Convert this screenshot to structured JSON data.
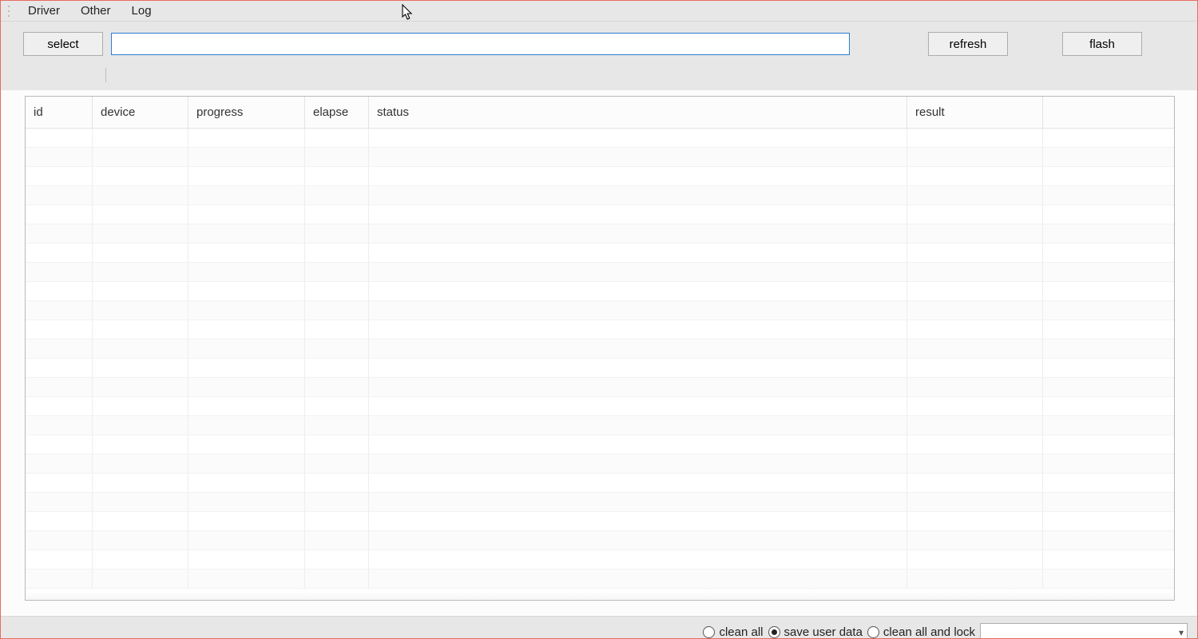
{
  "menubar": {
    "items": [
      "Driver",
      "Other",
      "Log"
    ]
  },
  "toolbar": {
    "select_label": "select",
    "refresh_label": "refresh",
    "flash_label": "flash",
    "path_value": "",
    "path_placeholder": ""
  },
  "table": {
    "columns": [
      "id",
      "device",
      "progress",
      "elapse",
      "status",
      "result",
      ""
    ],
    "row_count": 24
  },
  "footer": {
    "options": [
      {
        "label": "clean all",
        "checked": false
      },
      {
        "label": "save user data",
        "checked": true
      },
      {
        "label": "clean all and lock",
        "checked": false
      }
    ],
    "combo_value": ""
  }
}
